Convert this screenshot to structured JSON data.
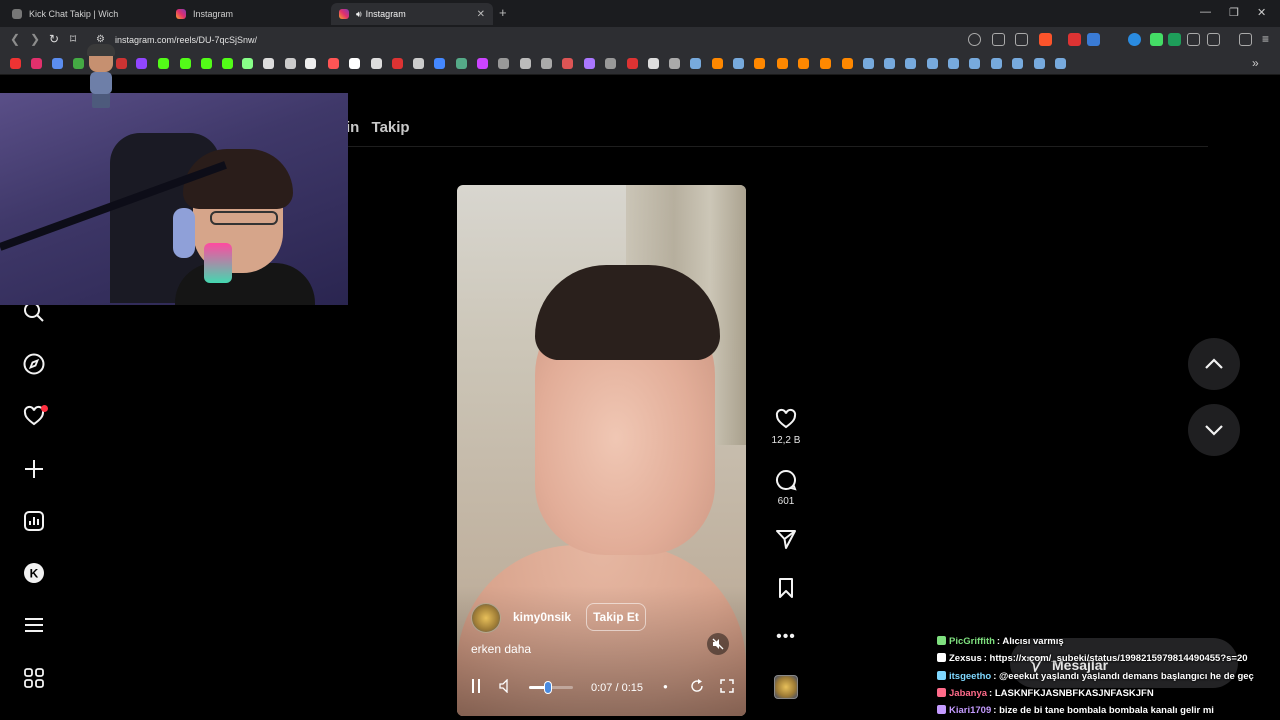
{
  "tabs": [
    {
      "title": "Kick Chat Takip | Wich",
      "active": false
    },
    {
      "title": "Instagram",
      "active": false
    },
    {
      "title": "Instagram",
      "active": true
    }
  ],
  "address": {
    "url": "instagram.com/reels/DU-7qcSjSnw/"
  },
  "header": {
    "prefix": "in",
    "follow_tab": "Takip"
  },
  "reel": {
    "username": "kimy0nsik",
    "follow_label": "Takip Et",
    "caption": "erken daha",
    "time": "0:07 / 0:15",
    "progress": 0.47
  },
  "actions": {
    "likes": "12,2 B",
    "comments": "601"
  },
  "messages_label": "Mesajlar",
  "chat": [
    {
      "user": "PicGriffith",
      "text": ": Alıcısı varmış",
      "color": "#7fe07f"
    },
    {
      "user": "Zexsus",
      "text": ": https://x.com/_subeki/status/1998215979814490455?s=20",
      "color": "#ffffff"
    },
    {
      "user": "itsgeetho",
      "text": ": @eeekut yaşlandı yaşlandı demans başlangıcı he de geç",
      "color": "#7fd8ff"
    },
    {
      "user": "Jabanya",
      "text": ": LASKNFKJASNBFKASJNFASKJFN",
      "color": "#ff6b8a"
    },
    {
      "user": "Kiari1709",
      "text": ": bize de bi tane bombala bombala kanalı gelir mi",
      "color": "#c49bff"
    }
  ],
  "colors": {
    "accent": "#ff3040",
    "bg": "#000000",
    "chrome": "#2d2e32"
  }
}
